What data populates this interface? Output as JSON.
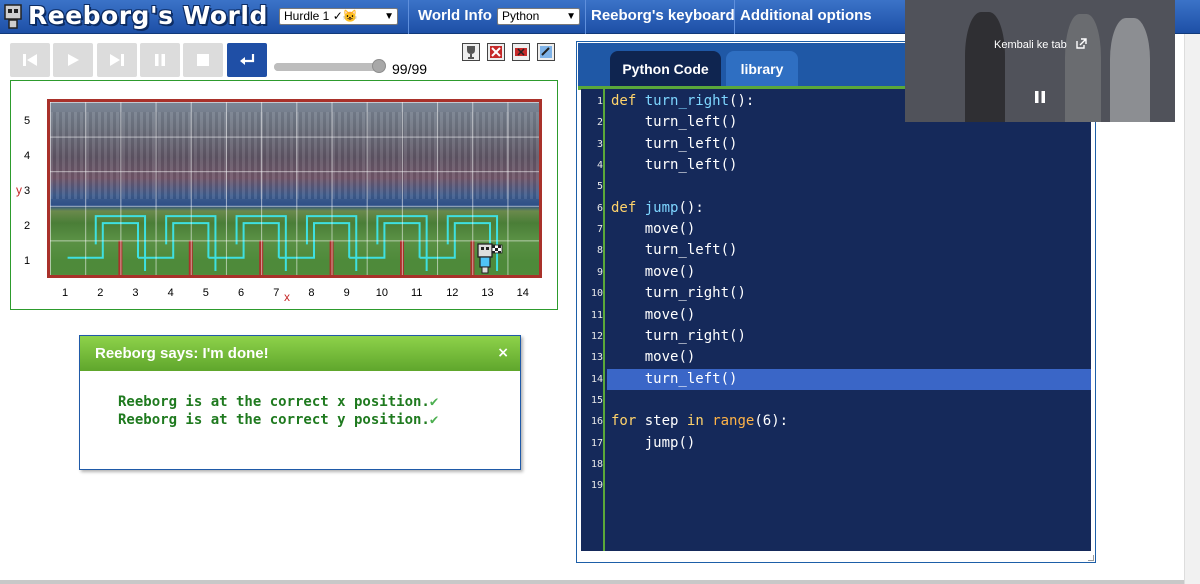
{
  "app": {
    "title": "Reeborg's World"
  },
  "header": {
    "world_select": "Hurdle 1 ✓😺",
    "world_info_label": "World Info",
    "language_select": "Python",
    "keyboard_label": "Reeborg's keyboard",
    "options_label": "Additional options"
  },
  "controls": {
    "reverse_step": "reverse-step-icon",
    "run": "play-icon",
    "step": "step-icon",
    "pause": "pause-icon",
    "stop": "stop-icon",
    "reload": "return-icon",
    "step_counter": "99/99",
    "progress": 1.0
  },
  "world": {
    "y_label": "y",
    "x_label": "x",
    "rows": [
      "5",
      "4",
      "3",
      "2",
      "1"
    ],
    "cols": [
      "1",
      "2",
      "3",
      "4",
      "5",
      "6",
      "7",
      "8",
      "9",
      "10",
      "11",
      "12",
      "13",
      "14"
    ]
  },
  "dialog": {
    "title": "Reeborg says: I'm done!",
    "close": "×",
    "line1": "Reeborg is at the correct x position.",
    "line2": "Reeborg is at the correct y position.",
    "check": "✔"
  },
  "editor": {
    "tab_code": "Python Code",
    "tab_library": "library",
    "highlighted_line": 14,
    "lines": [
      "def turn_right():",
      "    turn_left()",
      "    turn_left()",
      "    turn_left()",
      "",
      "def jump():",
      "    move()",
      "    turn_left()",
      "    move()",
      "    turn_right()",
      "    move()",
      "    turn_right()",
      "    move()",
      "    turn_left()",
      "",
      "for step in range(6):",
      "    jump()",
      "",
      ""
    ]
  },
  "pip": {
    "back_to_tab": "Kembali ke tab"
  },
  "colors": {
    "topbar": "#1d4fa6",
    "world_border": "#a9312a",
    "dialog_header": "#6cb434",
    "editor_bg": "#15295a",
    "highlight": "#3a66c7"
  }
}
